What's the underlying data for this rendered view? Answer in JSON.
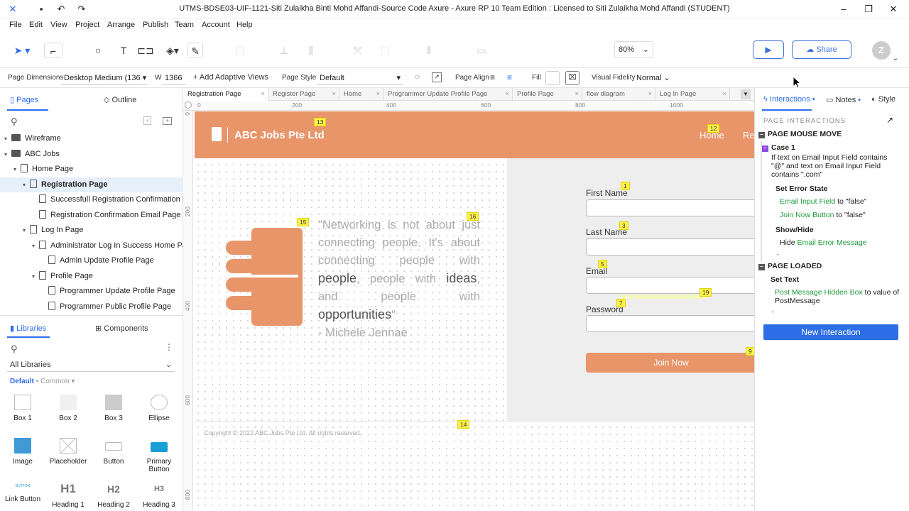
{
  "window": {
    "title": "UTMS-BDSE03-UIF-1121-Siti Zulaikha Binti Mohd Affandi-Source Code Axure - Axure RP 10 Team Edition : Licensed to Siti Zulaikha Mohd Affandi (STUDENT)"
  },
  "menu": [
    "File",
    "Edit",
    "View",
    "Project",
    "Arrange",
    "Publish",
    "Team",
    "Account",
    "Help"
  ],
  "toolbar": {
    "zoom": "80%",
    "share": "Share",
    "avatar": "Z"
  },
  "props": {
    "page_dimensions_label": "Page Dimensions",
    "page_dimensions_value": "Desktop Medium (136",
    "w_label": "W",
    "w_value": "1366",
    "adaptive": "+ Add Adaptive Views",
    "page_style_label": "Page Style",
    "page_style_value": "Default",
    "page_align_label": "Page Align",
    "fill_label": "Fill",
    "visual_fidelity_label": "Visual Fidelity",
    "visual_fidelity_value": "Normal"
  },
  "left": {
    "tab_pages": "Pages",
    "tab_outline": "Outline",
    "tree": [
      {
        "label": "Wireframe",
        "type": "folder",
        "indent": 0
      },
      {
        "label": "ABC Jobs",
        "type": "folder",
        "indent": 0
      },
      {
        "label": "Home Page",
        "type": "page",
        "indent": 1
      },
      {
        "label": "Registration Page",
        "type": "page",
        "indent": 2,
        "selected": true
      },
      {
        "label": "Successfull Registration Confirmation P",
        "type": "page",
        "indent": 3
      },
      {
        "label": "Registration Confirmation Email Page",
        "type": "page",
        "indent": 3
      },
      {
        "label": "Log In Page",
        "type": "page",
        "indent": 2
      },
      {
        "label": "Administrator Log In Success Home Pag",
        "type": "page",
        "indent": 3
      },
      {
        "label": "Admin Update Profile Page",
        "type": "page",
        "indent": 4
      },
      {
        "label": "Profile Page",
        "type": "page",
        "indent": 3
      },
      {
        "label": "Programmer Update Profile Page",
        "type": "page",
        "indent": 4
      },
      {
        "label": "Programmer Public Profile Page",
        "type": "page",
        "indent": 4
      }
    ],
    "tab_libraries": "Libraries",
    "tab_components": "Components",
    "library_select": "All Libraries",
    "library_group": "Default",
    "library_sub": "Common",
    "items": [
      "Box 1",
      "Box 2",
      "Box 3",
      "Ellipse",
      "Image",
      "Placeholder",
      "Button",
      "Primary Button",
      "Link Button",
      "Heading 1",
      "Heading 2",
      "Heading 3"
    ],
    "heading_glyphs": [
      "BUTTON",
      "H1",
      "H2",
      "H3"
    ]
  },
  "doc_tabs": [
    "Registration Page",
    "Register Page",
    "Home",
    "Programmer Update Profile Page",
    "Profile Page",
    "flow diagram",
    "Log In Page"
  ],
  "ruler": {
    "h": [
      "0",
      "200",
      "400",
      "600",
      "800",
      "1000"
    ],
    "v": [
      "0",
      "200",
      "400",
      "600",
      "800"
    ]
  },
  "design": {
    "brand": "ABC Jobs Pte Ltd",
    "nav": [
      "Home",
      "Re"
    ],
    "quote_parts": [
      "\"Networking is not about just connecting people. It's about connecting people with ",
      "people",
      ", people with ",
      "ideas",
      ", and people with ",
      "opportunities",
      "\""
    ],
    "quote_author": "- Michele Jennae",
    "labels": {
      "first": "First Name",
      "last": "Last Name",
      "email": "Email",
      "password": "Password"
    },
    "join": "Join Now",
    "footer": "Copyright © 2022 ABC Jobs Pte Ltd.  All rights reserved.",
    "badges": [
      "13",
      "12",
      "1",
      "3",
      "5",
      "7",
      "19",
      "9",
      "15",
      "16",
      "14"
    ]
  },
  "right": {
    "tab_interactions": "Interactions",
    "tab_notes": "Notes",
    "tab_style": "Style",
    "heading": "PAGE INTERACTIONS",
    "ev1": "PAGE MOUSE MOVE",
    "case": "Case 1",
    "cond": "If text on Email Input Field contains \"@\" and text on Email Input Field contains \".com\"",
    "a1": "Set Error State",
    "a1l1t": "Email Input Field",
    "a1l1v": " to \"false\"",
    "a1l2t": "Join Now Button",
    "a1l2v": " to \"false\"",
    "a2": "Show/Hide",
    "a2pre": "Hide ",
    "a2t": "Email Error Message",
    "ev2": "PAGE LOADED",
    "a3": "Set Text",
    "a3t": "Post Message Hidden Box",
    "a3v": " to value of PostMessage",
    "new": "New Interaction"
  },
  "colors": {
    "accent": "#2d6ee6",
    "brand": "#e8956a",
    "badge": "#fff14a"
  }
}
